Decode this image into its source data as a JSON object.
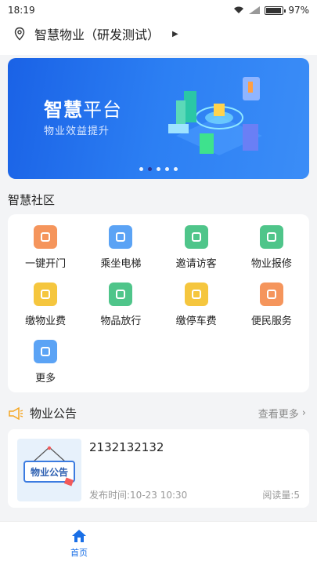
{
  "status": {
    "time": "18:19",
    "battery": "97%",
    "battery_level": 0.97
  },
  "location": {
    "name": "智慧物业（研发测试）"
  },
  "banner": {
    "title_bold": "智慧",
    "title_rest": "平台",
    "subtitle": "物业效益提升",
    "slide_count": 5,
    "active_slide": 1
  },
  "community": {
    "title": "智慧社区",
    "items": [
      {
        "label": "一键开门",
        "icon": "key-door-icon",
        "color": "#f58a4b"
      },
      {
        "label": "乘坐电梯",
        "icon": "elevator-icon",
        "color": "#4a9af5"
      },
      {
        "label": "邀请访客",
        "icon": "visitor-icon",
        "color": "#3cbf7e"
      },
      {
        "label": "物业报修",
        "icon": "repair-icon",
        "color": "#3cbf7e"
      },
      {
        "label": "缴物业费",
        "icon": "property-fee-icon",
        "color": "#f5c02a"
      },
      {
        "label": "物品放行",
        "icon": "item-release-icon",
        "color": "#3cbf7e"
      },
      {
        "label": "缴停车费",
        "icon": "parking-fee-icon",
        "color": "#f5c02a"
      },
      {
        "label": "便民服务",
        "icon": "service-icon",
        "color": "#f58a4b"
      },
      {
        "label": "更多",
        "icon": "more-grid-icon",
        "color": "#4a9af5"
      }
    ]
  },
  "notice": {
    "title": "物业公告",
    "more": "查看更多",
    "thumb_text": "物业公告",
    "items": [
      {
        "title": "2132132132",
        "time": "发布时间:10-23 10:30",
        "reads": "阅读量:5"
      }
    ]
  },
  "tabbar": {
    "home": "首页"
  },
  "colors": {
    "accent": "#1a6fe6",
    "banner": "#2c7ff3"
  }
}
